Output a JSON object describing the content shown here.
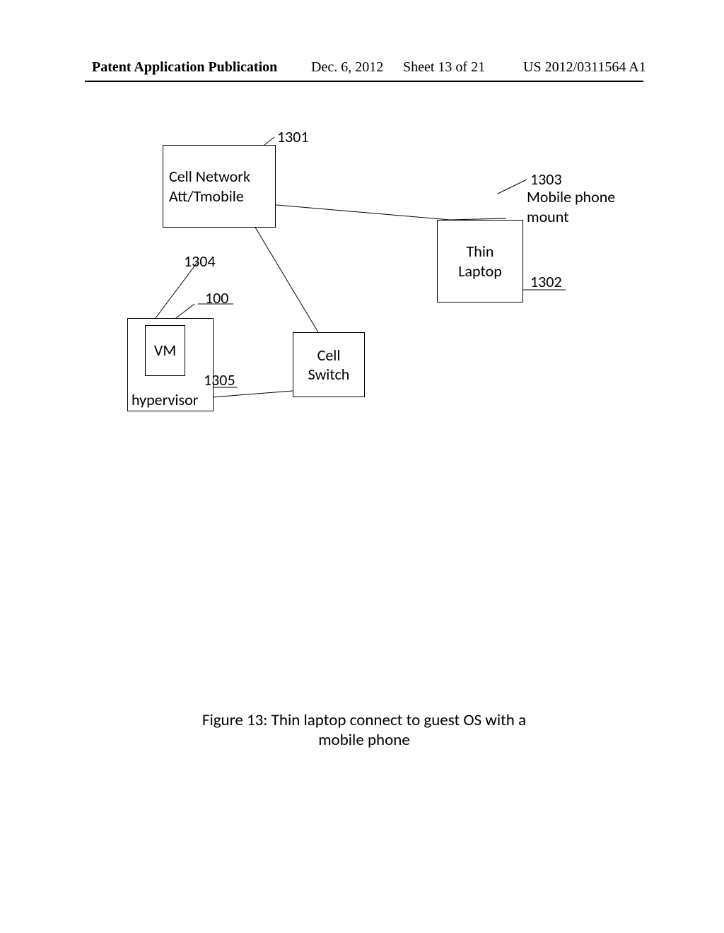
{
  "header": {
    "publication": "Patent Application Publication",
    "date": "Dec. 6, 2012",
    "sheet": "Sheet 13 of 21",
    "docnum": "US 2012/0311564 A1"
  },
  "boxes": {
    "cell_network": "Cell Network\nAtt/Tmobile",
    "thin_laptop": "Thin\nLaptop",
    "cell_switch": "Cell\nSwitch",
    "vm": "VM",
    "hypervisor": "hypervisor"
  },
  "labels": {
    "r1301": "1301",
    "r1302": "1302",
    "r1303": "1303",
    "mobile_phone_mount": "Mobile phone\nmount",
    "r1304": "1304",
    "r100": "100",
    "r1305": "1305"
  },
  "caption": {
    "line1": "Figure 13: Thin laptop connect to guest OS with a",
    "line2": "mobile phone"
  }
}
